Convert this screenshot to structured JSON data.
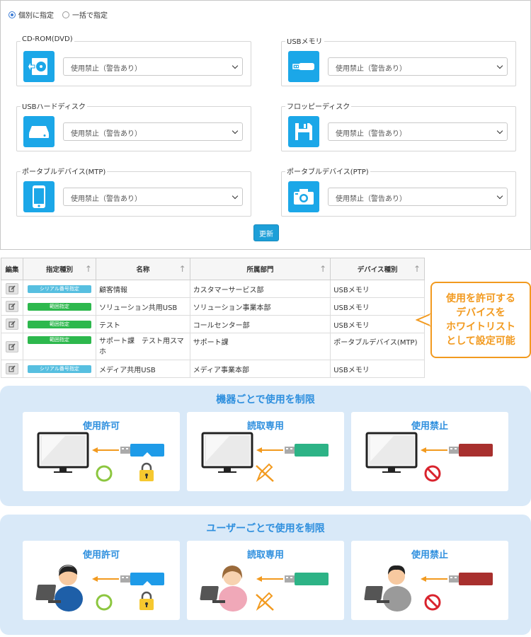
{
  "selection_mode": {
    "options": [
      {
        "label": "個別に指定",
        "selected": true
      },
      {
        "label": "一括で指定",
        "selected": false
      }
    ]
  },
  "devices": [
    {
      "label": "CD-ROM(DVD)",
      "icon": "cdrom-icon",
      "value": "使用禁止（警告あり）"
    },
    {
      "label": "USBメモリ",
      "icon": "usb-memory-icon",
      "value": "使用禁止（警告あり）"
    },
    {
      "label": "USBハードディスク",
      "icon": "usb-hdd-icon",
      "value": "使用禁止（警告あり）"
    },
    {
      "label": "フロッピーディスク",
      "icon": "floppy-icon",
      "value": "使用禁止（警告あり）"
    },
    {
      "label": "ポータブルデバイス(MTP)",
      "icon": "smartphone-icon",
      "value": "使用禁止（警告あり）"
    },
    {
      "label": "ポータブルデバイス(PTP)",
      "icon": "camera-icon",
      "value": "使用禁止（警告あり）"
    }
  ],
  "update_button": "更新",
  "table": {
    "headers": [
      "編集",
      "指定種別",
      "名称",
      "所属部門",
      "デバイス種別"
    ],
    "sort_glyph": "↑",
    "rows": [
      {
        "type": "シリアル番号指定",
        "type_kind": "serial",
        "name": "顧客情報",
        "dept": "カスタマーサービス部",
        "device": "USBメモリ"
      },
      {
        "type": "範囲指定",
        "type_kind": "range",
        "name": "ソリューション共用USB",
        "dept": "ソリューション事業本部",
        "device": "USBメモリ"
      },
      {
        "type": "範囲指定",
        "type_kind": "range",
        "name": "テスト",
        "dept": "コールセンター部",
        "device": "USBメモリ"
      },
      {
        "type": "範囲指定",
        "type_kind": "range",
        "name": "サポート課　テスト用スマホ",
        "dept": "サポート課",
        "device": "ポータブルデバイス(MTP)"
      },
      {
        "type": "シリアル番号指定",
        "type_kind": "serial",
        "name": "メディア共用USB",
        "dept": "メディア事業本部",
        "device": "USBメモリ"
      }
    ]
  },
  "callout": {
    "lines": [
      "使用を許可する",
      "デバイスを",
      "ホワイトリスト",
      "として設定可能"
    ]
  },
  "device_section": {
    "title": "機器ごとで使用を制限",
    "cards": [
      {
        "title": "使用許可",
        "usb_color": "#1e9be8",
        "status": "allow"
      },
      {
        "title": "読取専用",
        "usb_color": "#2db386",
        "status": "readonly"
      },
      {
        "title": "使用禁止",
        "usb_color": "#a8302e",
        "status": "deny"
      }
    ]
  },
  "user_section": {
    "title": "ユーザーごとで使用を制限",
    "cards": [
      {
        "title": "使用許可",
        "usb_color": "#1e9be8",
        "status": "allow"
      },
      {
        "title": "読取専用",
        "usb_color": "#2db386",
        "status": "readonly"
      },
      {
        "title": "使用禁止",
        "usb_color": "#a8302e",
        "status": "deny"
      }
    ]
  },
  "colors": {
    "accent_blue": "#1ba7e8",
    "callout_orange": "#f29a1f",
    "section_bg": "#d9e9f8"
  }
}
